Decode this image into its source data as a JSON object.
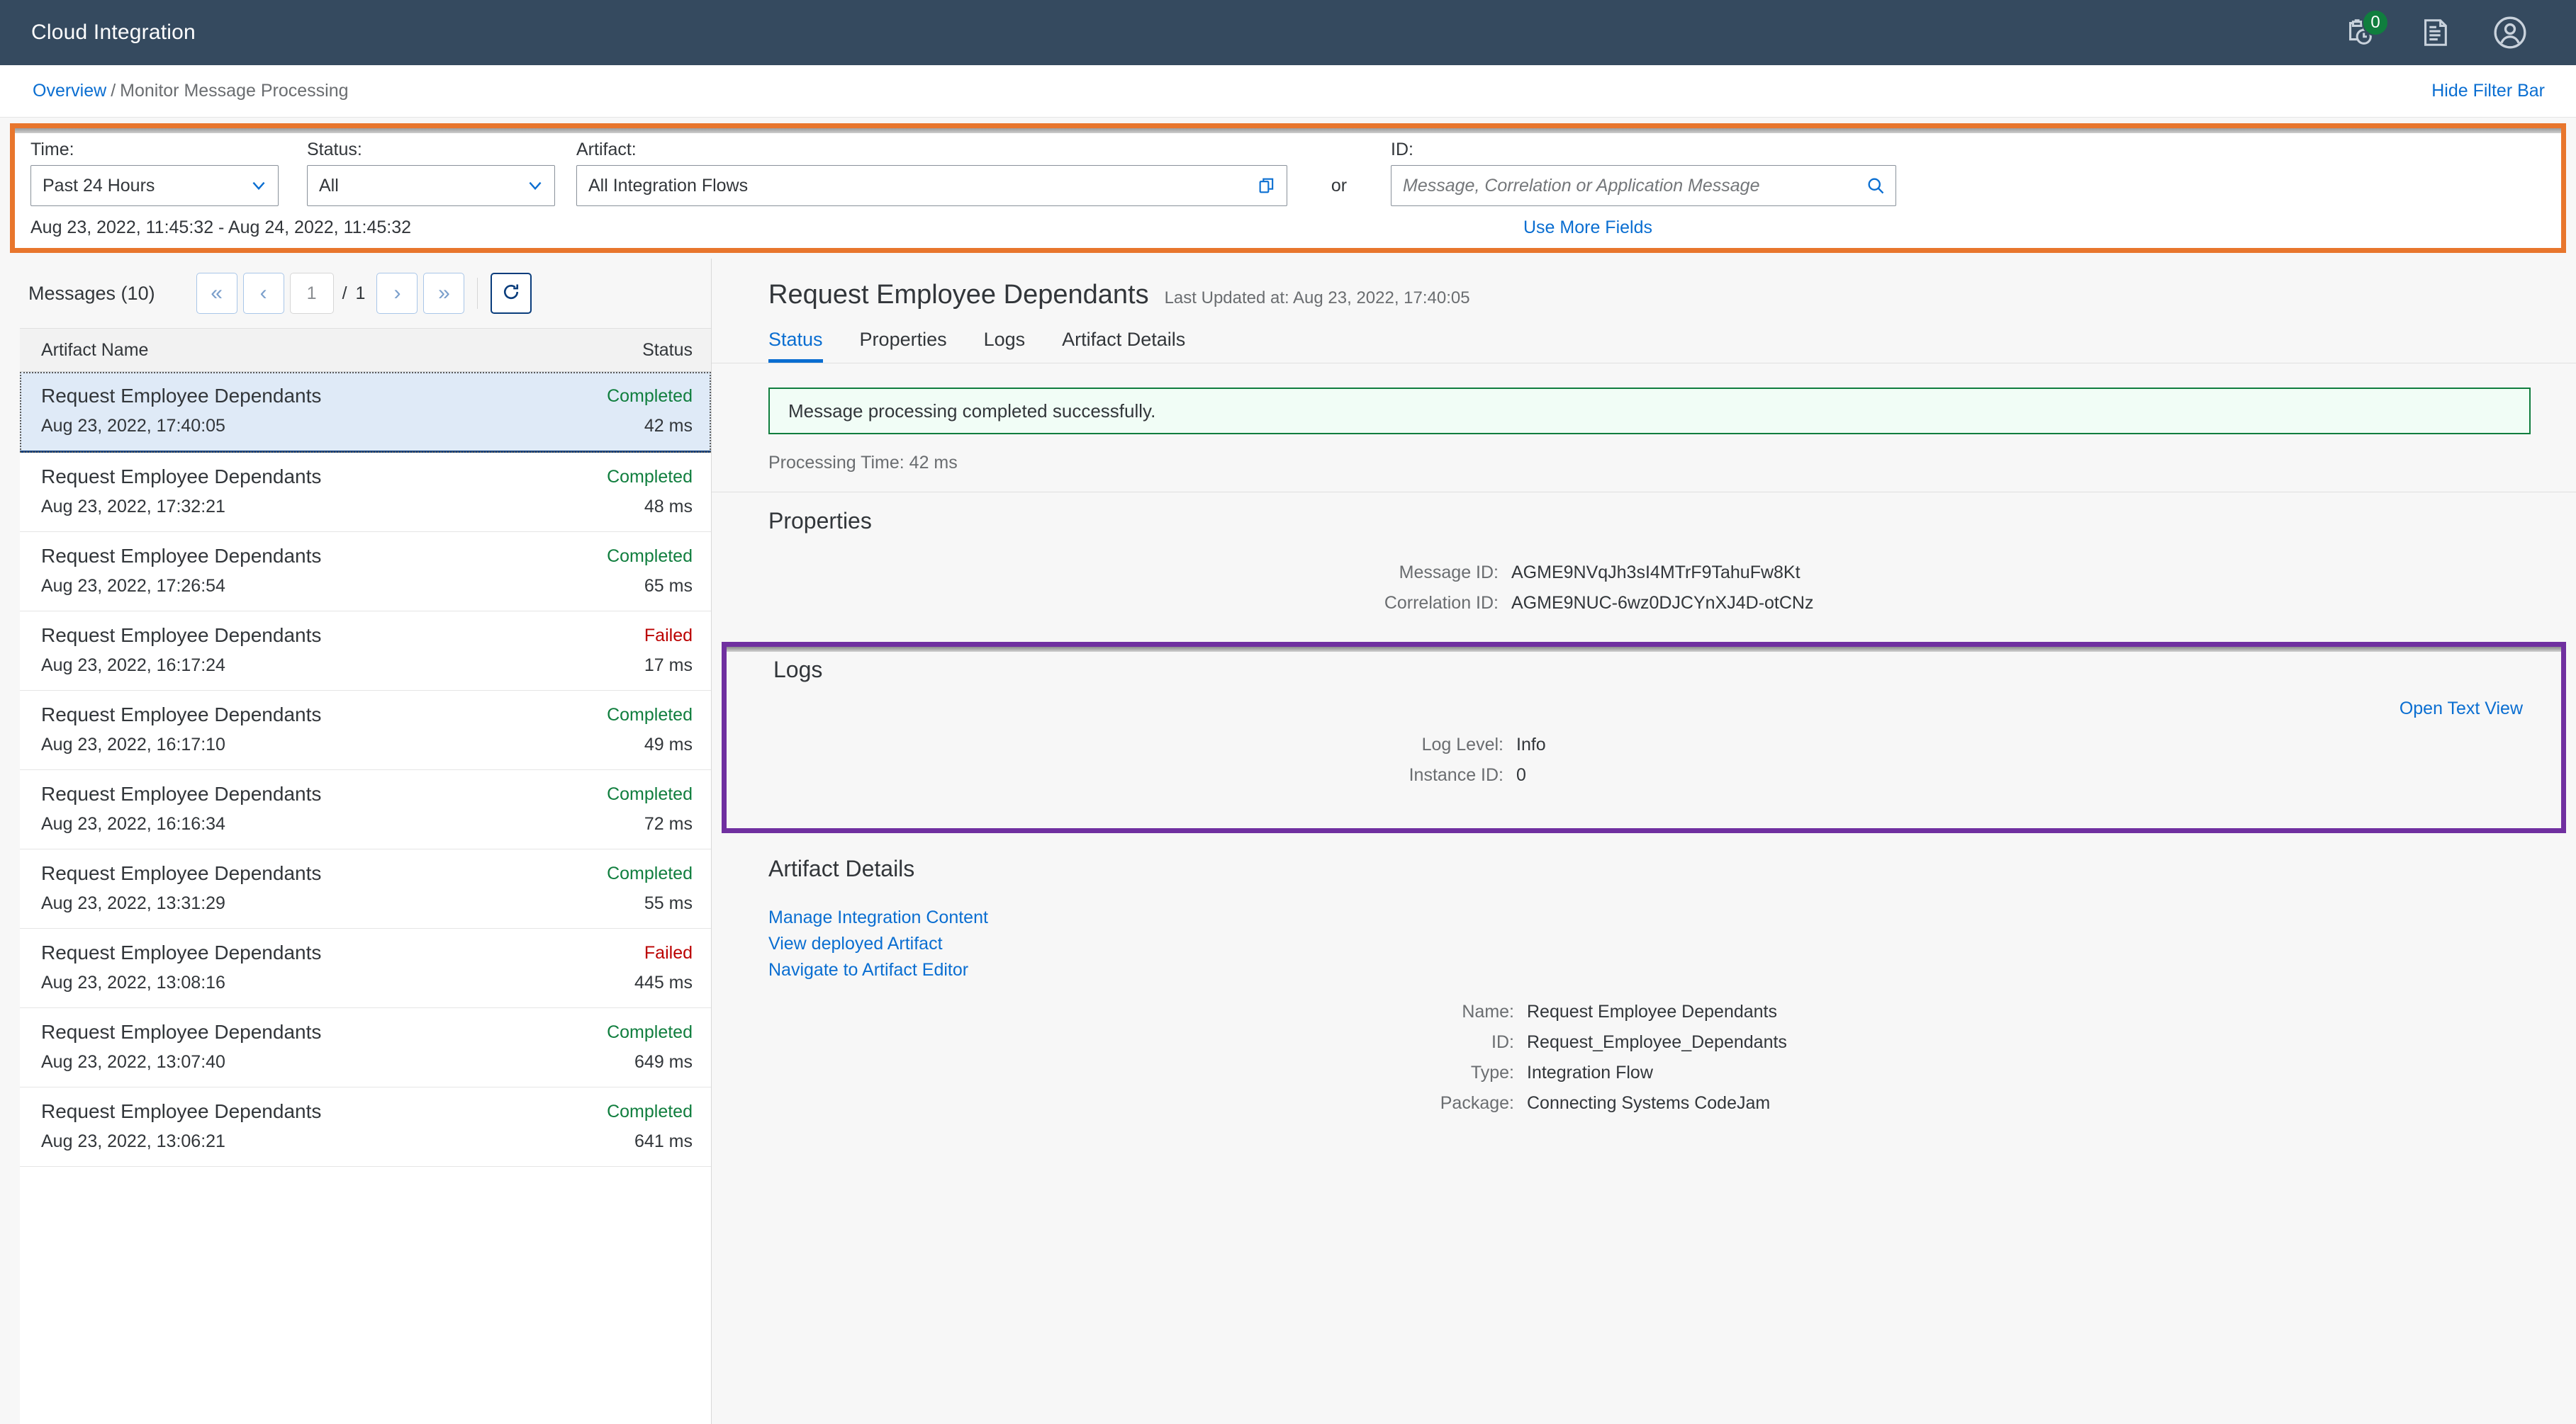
{
  "shell": {
    "title": "Cloud Integration",
    "icons": [
      {
        "name": "tasks-clipboard-icon",
        "badge": "0"
      },
      {
        "name": "logs-document-icon",
        "badge": null
      },
      {
        "name": "user-avatar-icon",
        "badge": null
      }
    ]
  },
  "breadcrumb": {
    "root": "Overview",
    "separator": "/",
    "current": "Monitor Message Processing",
    "hide_filter_bar": "Hide Filter Bar"
  },
  "filter": {
    "time_label": "Time:",
    "time_value": "Past 24 Hours",
    "status_label": "Status:",
    "status_value": "All",
    "artifact_label": "Artifact:",
    "artifact_value": "All Integration Flows",
    "or_text": "or",
    "id_label": "ID:",
    "id_placeholder": "Message, Correlation or Application Message",
    "id_value": "",
    "range_text": "Aug 23, 2022, 11:45:32 - Aug 24, 2022, 11:45:32",
    "use_more_fields": "Use More Fields",
    "highlight_color": "#e8762d"
  },
  "list": {
    "title": "Messages (10)",
    "pager": {
      "first": "«",
      "prev": "‹",
      "page": "1",
      "slash": "/",
      "total": "1",
      "next": "›",
      "last": "»",
      "refresh": "refresh-icon"
    },
    "columns": [
      "Artifact Name",
      "Status"
    ],
    "rows": [
      {
        "name": "Request Employee Dependants",
        "status": "Completed",
        "status_kind": "completed",
        "date": "Aug 23, 2022, 17:40:05",
        "duration": "42 ms",
        "selected": true
      },
      {
        "name": "Request Employee Dependants",
        "status": "Completed",
        "status_kind": "completed",
        "date": "Aug 23, 2022, 17:32:21",
        "duration": "48 ms",
        "selected": false
      },
      {
        "name": "Request Employee Dependants",
        "status": "Completed",
        "status_kind": "completed",
        "date": "Aug 23, 2022, 17:26:54",
        "duration": "65 ms",
        "selected": false
      },
      {
        "name": "Request Employee Dependants",
        "status": "Failed",
        "status_kind": "failed",
        "date": "Aug 23, 2022, 16:17:24",
        "duration": "17 ms",
        "selected": false
      },
      {
        "name": "Request Employee Dependants",
        "status": "Completed",
        "status_kind": "completed",
        "date": "Aug 23, 2022, 16:17:10",
        "duration": "49 ms",
        "selected": false
      },
      {
        "name": "Request Employee Dependants",
        "status": "Completed",
        "status_kind": "completed",
        "date": "Aug 23, 2022, 16:16:34",
        "duration": "72 ms",
        "selected": false
      },
      {
        "name": "Request Employee Dependants",
        "status": "Completed",
        "status_kind": "completed",
        "date": "Aug 23, 2022, 13:31:29",
        "duration": "55 ms",
        "selected": false
      },
      {
        "name": "Request Employee Dependants",
        "status": "Failed",
        "status_kind": "failed",
        "date": "Aug 23, 2022, 13:08:16",
        "duration": "445 ms",
        "selected": false
      },
      {
        "name": "Request Employee Dependants",
        "status": "Completed",
        "status_kind": "completed",
        "date": "Aug 23, 2022, 13:07:40",
        "duration": "649 ms",
        "selected": false
      },
      {
        "name": "Request Employee Dependants",
        "status": "Completed",
        "status_kind": "completed",
        "date": "Aug 23, 2022, 13:06:21",
        "duration": "641 ms",
        "selected": false
      }
    ]
  },
  "detail": {
    "title": "Request Employee Dependants",
    "last_updated": "Last Updated at: Aug 23, 2022, 17:40:05",
    "tabs": [
      {
        "label": "Status",
        "active": true
      },
      {
        "label": "Properties",
        "active": false
      },
      {
        "label": "Logs",
        "active": false
      },
      {
        "label": "Artifact Details",
        "active": false
      }
    ],
    "status": {
      "message": "Message processing completed successfully.",
      "processing_time": "Processing Time: 42 ms",
      "success_color": "#107e3e"
    },
    "properties": {
      "heading": "Properties",
      "rows": [
        {
          "label": "Message ID:",
          "value": "AGME9NVqJh3sI4MTrF9TahuFw8Kt"
        },
        {
          "label": "Correlation ID:",
          "value": "AGME9NUC-6wz0DJCYnXJ4D-otCNz"
        }
      ]
    },
    "logs": {
      "heading": "Logs",
      "open_text_view": "Open Text View",
      "rows": [
        {
          "label": "Log Level:",
          "value": "Info"
        },
        {
          "label": "Instance ID:",
          "value": "0"
        }
      ],
      "highlight_color": "#7030a0"
    },
    "artifact_details": {
      "heading": "Artifact Details",
      "links": [
        "Manage Integration Content",
        "View deployed Artifact",
        "Navigate to Artifact Editor"
      ],
      "rows": [
        {
          "label": "Name:",
          "value": "Request Employee Dependants"
        },
        {
          "label": "ID:",
          "value": "Request_Employee_Dependants"
        },
        {
          "label": "Type:",
          "value": "Integration Flow"
        },
        {
          "label": "Package:",
          "value": "Connecting Systems CodeJam"
        }
      ]
    }
  }
}
